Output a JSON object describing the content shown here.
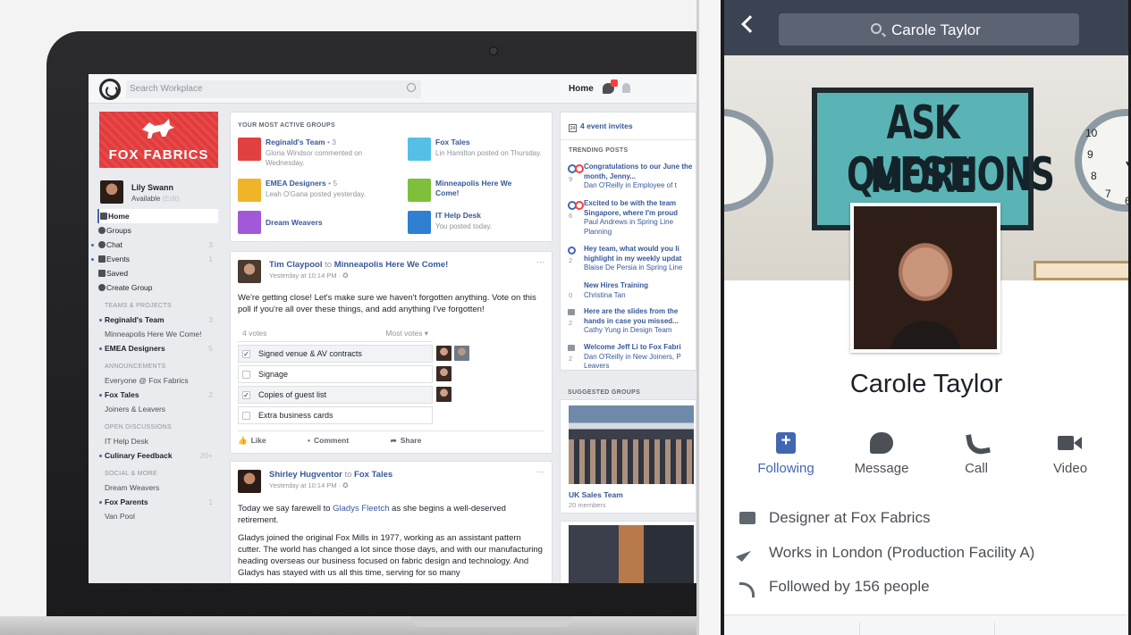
{
  "laptop": {
    "topbar": {
      "search_placeholder": "Search Workplace",
      "home_label": "Home",
      "notification_count": "2"
    },
    "left": {
      "banner_text": "FOX FABRICS",
      "me": {
        "name": "Lily Swann",
        "status": "Available",
        "edit": "(Edit)"
      },
      "nav": [
        {
          "label": "Home",
          "count": ""
        },
        {
          "label": "Groups",
          "count": ""
        },
        {
          "label": "Chat",
          "count": "3"
        },
        {
          "label": "Events",
          "count": "1"
        },
        {
          "label": "Saved",
          "count": ""
        },
        {
          "label": "Create Group",
          "count": ""
        }
      ],
      "sections": [
        {
          "title": "TEAMS & PROJECTS",
          "items": [
            {
              "label": "Reginald's Team",
              "count": "3",
              "bold": true
            },
            {
              "label": "Minneapolis Here We Come!",
              "count": "",
              "bold": false
            },
            {
              "label": "EMEA Designers",
              "count": "5",
              "bold": true
            }
          ]
        },
        {
          "title": "ANNOUNCEMENTS",
          "items": [
            {
              "label": "Everyone @ Fox Fabrics",
              "count": "",
              "bold": false
            },
            {
              "label": "Fox Tales",
              "count": "2",
              "bold": true
            },
            {
              "label": "Joiners & Leavers",
              "count": "",
              "bold": false
            }
          ]
        },
        {
          "title": "OPEN DISCUSSIONS",
          "items": [
            {
              "label": "IT Help Desk",
              "count": "",
              "bold": false
            },
            {
              "label": "Culinary Feedback",
              "count": "20+",
              "bold": true
            }
          ]
        },
        {
          "title": "SOCIAL & MORE",
          "items": [
            {
              "label": "Dream Weavers",
              "count": "",
              "bold": false
            },
            {
              "label": "Fox Parents",
              "count": "1",
              "bold": true
            },
            {
              "label": "Van Pool",
              "count": "",
              "bold": false
            }
          ]
        }
      ]
    },
    "groups": {
      "caption": "YOUR MOST ACTIVE GROUPS",
      "items": [
        {
          "name": "Reginald's Team",
          "count": " • 3",
          "sub": "Gloria Windsor commented on Wednesday.",
          "color": "#e0413f"
        },
        {
          "name": "Fox Tales",
          "count": "",
          "sub": "Lin Hamilton posted on Thursday.",
          "color": "#55bfe8"
        },
        {
          "name": "EMEA Designers",
          "count": " • 5",
          "sub": "Leah O'Gana posted yesterday.",
          "color": "#f0b429"
        },
        {
          "name": "Minneapolis Here We Come!",
          "count": "",
          "sub": "",
          "color": "#7ec03b"
        },
        {
          "name": "Dream Weavers",
          "count": "",
          "sub": "",
          "color": "#a259d9"
        },
        {
          "name": "IT Help Desk",
          "count": "",
          "sub": "You posted today.",
          "color": "#2f7fd3"
        }
      ]
    },
    "post1": {
      "author": "Tim Claypool",
      "to": "to",
      "group": "Minneapolis Here We Come!",
      "time": "Yesterday at 10:14 PM · ✪",
      "text": "We're getting close! Let's make sure we haven't forgotten anything. Vote on this poll if you're all over these things, and add anything I've forgotten!",
      "votes": "4 votes",
      "sort": "Most votes ▾",
      "options": [
        {
          "label": "Signed venue & AV contracts",
          "checked": "✓"
        },
        {
          "label": "Signage",
          "checked": ""
        },
        {
          "label": "Copies of guest list",
          "checked": "✓"
        },
        {
          "label": "Extra business cards",
          "checked": ""
        }
      ],
      "actions": {
        "like": "Like",
        "comment": "Comment",
        "share": "Share"
      },
      "more": "···"
    },
    "post2": {
      "author": "Shirley Hugventor",
      "to": "to",
      "group": "Fox Tales",
      "time": "Yesterday at 10:14 PM · ✪",
      "text_a": "Today we say farewell to ",
      "text_link": "Gladys Fleetch",
      "text_b": " as she begins a well-deserved retirement.",
      "text2": "Gladys joined the original Fox Mills in 1977, working as an assistant pattern cutter. The world has changed a lot since those days, and with our manufacturing heading overseas our business focused on fabric design and technology. And Gladys has stayed with us all this time, serving for so many",
      "more": "···"
    },
    "right": {
      "events": "4 event invites",
      "trending_caption": "TRENDING POSTS",
      "trending": [
        {
          "n": "9",
          "title": "Congratulations to our June the month, Jenny...",
          "sub": "Dan O'Reilly in Employee of t"
        },
        {
          "n": "6",
          "title": "Excited to be with the team Singapore, where I'm proud",
          "sub": "Paul Andrews in Spring Line Planning"
        },
        {
          "n": "2",
          "title": "Hey team, what would you li highlight in my weekly updat",
          "sub": "Blaise De Persia in Spring Line"
        },
        {
          "n": "0",
          "title": "New Hires Training",
          "sub": "Christina Tan"
        },
        {
          "n": "2",
          "title": "Here are the slides from the hands in case you missed...",
          "sub": "Cathy Yung in Design Team"
        },
        {
          "n": "2",
          "title": "Welcome Jeff Li to Fox Fabri",
          "sub": "Dan O'Reilly in New Joiners, P Leavers"
        }
      ],
      "suggested_caption": "SUGGESTED GROUPS",
      "suggested": {
        "name": "UK Sales Team",
        "members": "20 members"
      }
    }
  },
  "phone": {
    "search_query": "Carole Taylor",
    "poster_lines": [
      "ASK MORE",
      "QUESTIONS"
    ],
    "name": "Carole Taylor",
    "actions": [
      {
        "label": "Following",
        "icon": "following-icon"
      },
      {
        "label": "Message",
        "icon": "message-icon"
      },
      {
        "label": "Call",
        "icon": "call-icon"
      },
      {
        "label": "Video",
        "icon": "video-icon"
      }
    ],
    "info": [
      {
        "text": "Designer at Fox Fabrics",
        "icon": "briefcase-icon"
      },
      {
        "text": "Works in London (Production Facility A)",
        "icon": "location-arrow-icon"
      },
      {
        "text": "Followed by 156 people",
        "icon": "rss-icon"
      }
    ],
    "colors": {
      "accent": "#4267b2",
      "bar": "#3b4252"
    }
  }
}
